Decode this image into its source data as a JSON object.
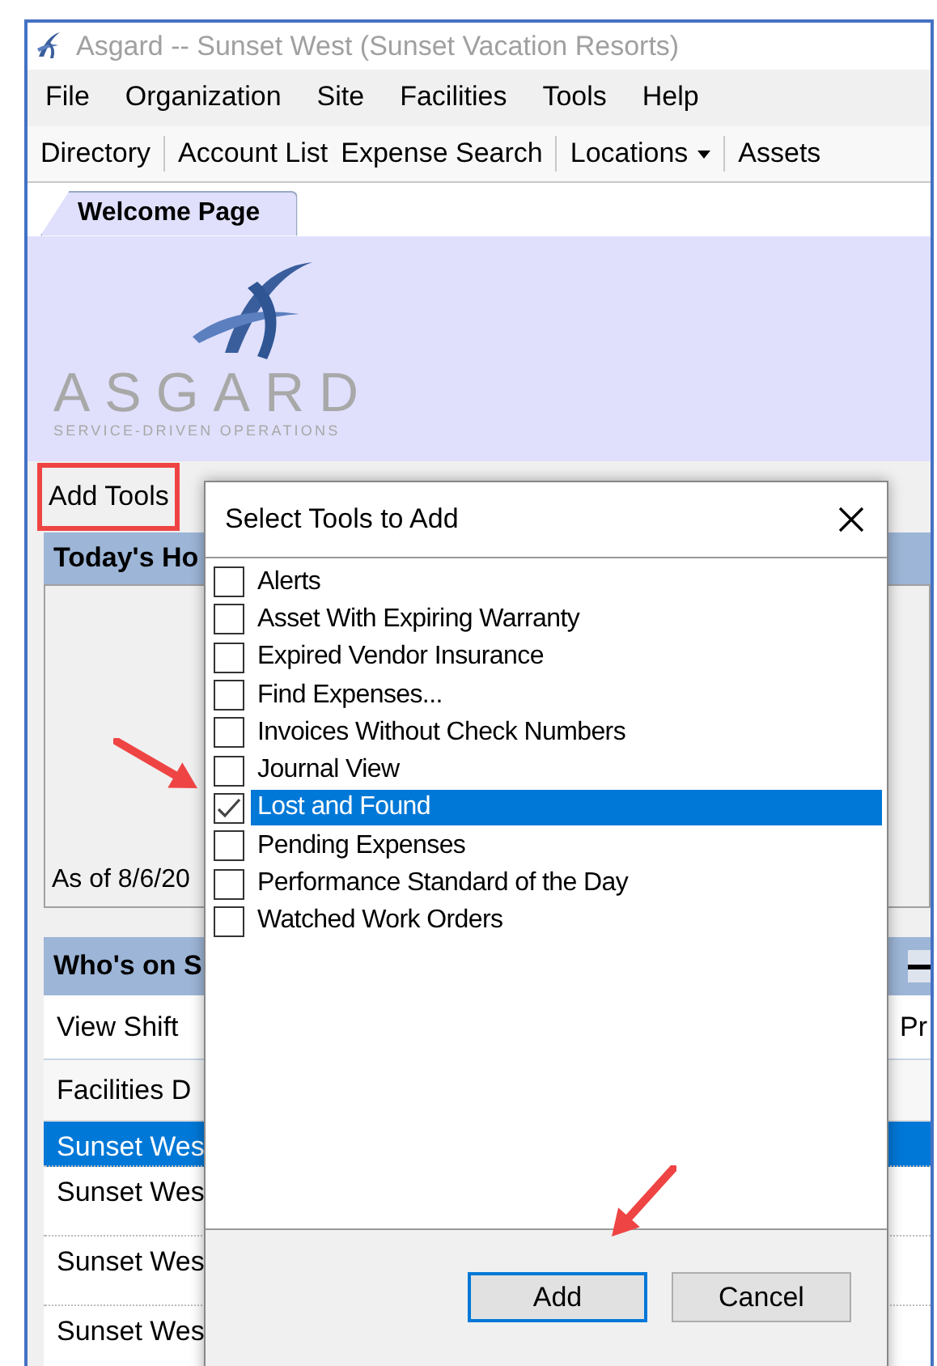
{
  "window": {
    "title": "Asgard -- Sunset West (Sunset Vacation Resorts)"
  },
  "menu": [
    "File",
    "Organization",
    "Site",
    "Facilities",
    "Tools",
    "Help"
  ],
  "toolbar": [
    {
      "kind": "button",
      "label": "Directory"
    },
    {
      "kind": "separator"
    },
    {
      "kind": "button",
      "label": "Account List"
    },
    {
      "kind": "button",
      "label": "Expense Search"
    },
    {
      "kind": "separator"
    },
    {
      "kind": "dropdown",
      "label": "Locations"
    },
    {
      "kind": "separator"
    },
    {
      "kind": "button",
      "label": "Assets"
    }
  ],
  "tabs": [
    {
      "label": "Welcome Page",
      "selected": true
    }
  ],
  "logo": {
    "name": "ASGARD",
    "tagline": "SERVICE-DRIVEN OPERATIONS"
  },
  "add_tools": {
    "label": "Add Tools",
    "highlighted": true
  },
  "hours_panel": {
    "title": "Today's Ho",
    "footer": "As of 8/6/20"
  },
  "shift_panel": {
    "title": "Who's on S",
    "actions": [
      "View Shift",
      "Pr"
    ],
    "column": "Facilities D",
    "rows": [
      {
        "text": "Sunset Wes",
        "selected": true
      },
      {
        "text": "Sunset Wes",
        "selected": false
      },
      {
        "text": "Sunset Wes",
        "selected": false
      },
      {
        "text": "Sunset Wes",
        "selected": false
      }
    ]
  },
  "dialog": {
    "title": "Select Tools to Add",
    "items": [
      {
        "label": "Alerts",
        "checked": false,
        "selected": false
      },
      {
        "label": "Asset With Expiring Warranty",
        "checked": false,
        "selected": false
      },
      {
        "label": "Expired Vendor Insurance",
        "checked": false,
        "selected": false
      },
      {
        "label": "Find Expenses...",
        "checked": false,
        "selected": false
      },
      {
        "label": "Invoices Without Check Numbers",
        "checked": false,
        "selected": false
      },
      {
        "label": "Journal View",
        "checked": false,
        "selected": false
      },
      {
        "label": "Lost and Found",
        "checked": true,
        "selected": true
      },
      {
        "label": "Pending Expenses",
        "checked": false,
        "selected": false
      },
      {
        "label": "Performance Standard of the Day",
        "checked": false,
        "selected": false
      },
      {
        "label": "Watched Work Orders",
        "checked": false,
        "selected": false
      }
    ],
    "buttons": [
      {
        "label": "Add",
        "default": true
      },
      {
        "label": "Cancel",
        "default": false
      }
    ]
  }
}
